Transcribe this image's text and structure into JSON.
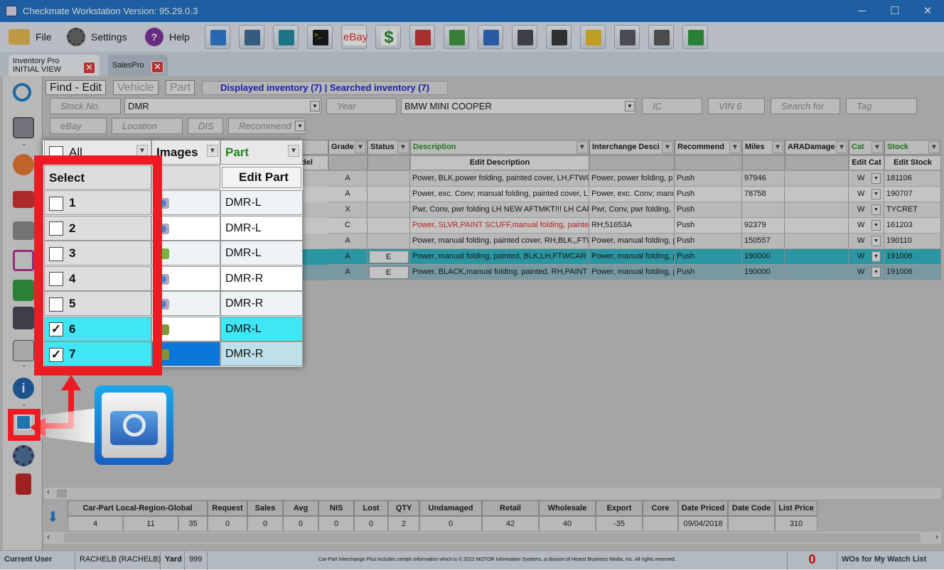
{
  "window": {
    "title": "Checkmate Workstation  Version: 95.29.0.3",
    "minimize": "─",
    "maximize": "☐",
    "close": "✕"
  },
  "menu": {
    "file": "File",
    "settings": "Settings",
    "help": "Help"
  },
  "toolbar_icons": [
    "inventory-icon",
    "chart-icon",
    "images-icon",
    "terminal-icon",
    "ebay-icon",
    "dollar-icon",
    "auction-icon",
    "settings-green-icon",
    "report-icon",
    "user-icon",
    "graduation-icon",
    "lock-icon",
    "cash-register-icon",
    "clipboard-icon",
    "refresh-icon"
  ],
  "toolbar": {
    "ebay_label": "eBay",
    "dollar_label": "$",
    "terminal_label": ">_"
  },
  "doc_tabs": [
    {
      "line1": "Inventory Pro",
      "line2": "INITIAL VIEW"
    },
    {
      "line1": "SalesPro",
      "line2": ""
    }
  ],
  "sub_tabs": [
    "Find - Edit",
    "Vehicle",
    "Part"
  ],
  "inventory_info": {
    "displayed": "Displayed inventory (7)",
    "sep": "|",
    "searched": "Searched inventory (7)"
  },
  "search": {
    "stock_no": "Stock No.",
    "part_value": "DMR",
    "year": "Year",
    "model_value": "BMW MINI COOPER",
    "ic": "IC",
    "vin6": "VIN 6",
    "search_for": "Search for",
    "tag": "Tag",
    "ebay": "eBay",
    "location": "Location",
    "dis": "DIS",
    "recommend": "Recommend"
  },
  "grid": {
    "columns": [
      "Grade",
      "Status",
      "Description",
      "Interchange Desci",
      "Recommend",
      "Miles",
      "ARADamage",
      "Cat",
      "Stock"
    ],
    "sub_headers": {
      "model_partial": "del",
      "description": "Edit Description",
      "cat": "Edit Cat",
      "stock": "Edit Stock"
    },
    "rows": [
      {
        "grade": "A",
        "status": "",
        "description": "Power, BLK,power folding, painted cover, LH,FTWC",
        "interchange": "Power, power folding, p",
        "recommend": "Push",
        "miles": "97946",
        "ara": "",
        "cat": "W",
        "stock": "181106",
        "red": false,
        "state": "normal"
      },
      {
        "grade": "A",
        "status": "",
        "description": "Power, exc. Conv; manual folding, painted cover, LI",
        "interchange": "Power, exc. Conv; manu",
        "recommend": "Push",
        "miles": "78758",
        "ara": "",
        "cat": "W",
        "stock": "190707",
        "red": false,
        "state": "normal"
      },
      {
        "grade": "X",
        "status": "",
        "description": "Pwr, Conv, pwr folding LH NEW AFTMKT!!! LH CAP I",
        "interchange": "Pwr, Conv, pwr folding,",
        "recommend": "Push",
        "miles": "",
        "ara": "",
        "cat": "W",
        "stock": "TYCRET",
        "red": false,
        "state": "normal"
      },
      {
        "grade": "C",
        "status": "",
        "description": "Power, SLVR,PAINT SCUFF,manual folding, painted",
        "interchange": "RH;51653A",
        "recommend": "Push",
        "miles": "92379",
        "ara": "",
        "cat": "W",
        "stock": "161203",
        "red": true,
        "state": "normal"
      },
      {
        "grade": "A",
        "status": "",
        "description": "Power, manual folding, painted cover, RH,BLK,,FTW",
        "interchange": "Power, manual folding, p",
        "recommend": "Push",
        "miles": "150557",
        "ara": "",
        "cat": "W",
        "stock": "190110",
        "red": false,
        "state": "normal"
      },
      {
        "grade": "A",
        "status": "E",
        "description": "Power, manual folding, painted, BLK,LH,FTWCAR",
        "interchange": "Power, manual folding, p",
        "recommend": "Push",
        "miles": "190000",
        "ara": "",
        "cat": "W",
        "stock": "191006",
        "red": false,
        "state": "selected"
      },
      {
        "grade": "A",
        "status": "E",
        "description": "Power, BLACK,manual folding, painted, RH,PAINT C",
        "interchange": "Power, manual folding, p",
        "recommend": "Push",
        "miles": "190000",
        "ara": "",
        "cat": "W",
        "stock": "191006",
        "red": false,
        "state": "checked"
      }
    ]
  },
  "popup": {
    "all_label": "All",
    "images_label": "Images",
    "part_label": "Part",
    "select_label": "Select",
    "edit_part_label": "Edit Part",
    "rows": [
      {
        "num": "1",
        "checked": false,
        "image": "camera-icon",
        "part": "DMR-L"
      },
      {
        "num": "2",
        "checked": false,
        "image": "camera-icon",
        "part": "DMR-L"
      },
      {
        "num": "3",
        "checked": false,
        "image": "add-image-icon",
        "part": "DMR-L"
      },
      {
        "num": "4",
        "checked": false,
        "image": "camera-icon",
        "part": "DMR-R"
      },
      {
        "num": "5",
        "checked": false,
        "image": "camera-icon",
        "part": "DMR-R"
      },
      {
        "num": "6",
        "checked": true,
        "image": "car-icon",
        "part": "DMR-L"
      },
      {
        "num": "7",
        "checked": true,
        "image": "car-icon",
        "part": "DMR-R"
      }
    ]
  },
  "stats": {
    "headers": [
      "Car-Part Local-Region-Global",
      "Request",
      "Sales",
      "Avg",
      "NIS",
      "Lost",
      "QTY",
      "Undamaged",
      "Retail",
      "Wholesale",
      "Export",
      "Core",
      "Date Priced",
      "Date Code",
      "List Price"
    ],
    "values": [
      "4",
      "11",
      "35",
      "0",
      "0",
      "0",
      "0",
      "0",
      "2",
      "0",
      "42",
      "40",
      "-35",
      "",
      "09/04/2018",
      "",
      "310"
    ]
  },
  "statusbar": {
    "current_user_label": "Current User",
    "user": "RACHELB (RACHELB)",
    "yard_label": "Yard",
    "yard": "999",
    "copyright": "Car-Part Interchange Plus includes certain information which is © 2022 MOTOR Information Systems, a division of Hearst Business Media, Inc. All rights reserved.",
    "count": "0",
    "watch_list": "WOs for My Watch List"
  },
  "colors": {
    "accent": "#1a6fc4",
    "highlight_red": "#ed1c24",
    "selected_row": "#2bb5c4",
    "checked_cyan": "#3fe6f5",
    "green_header": "#1d8a1d"
  }
}
